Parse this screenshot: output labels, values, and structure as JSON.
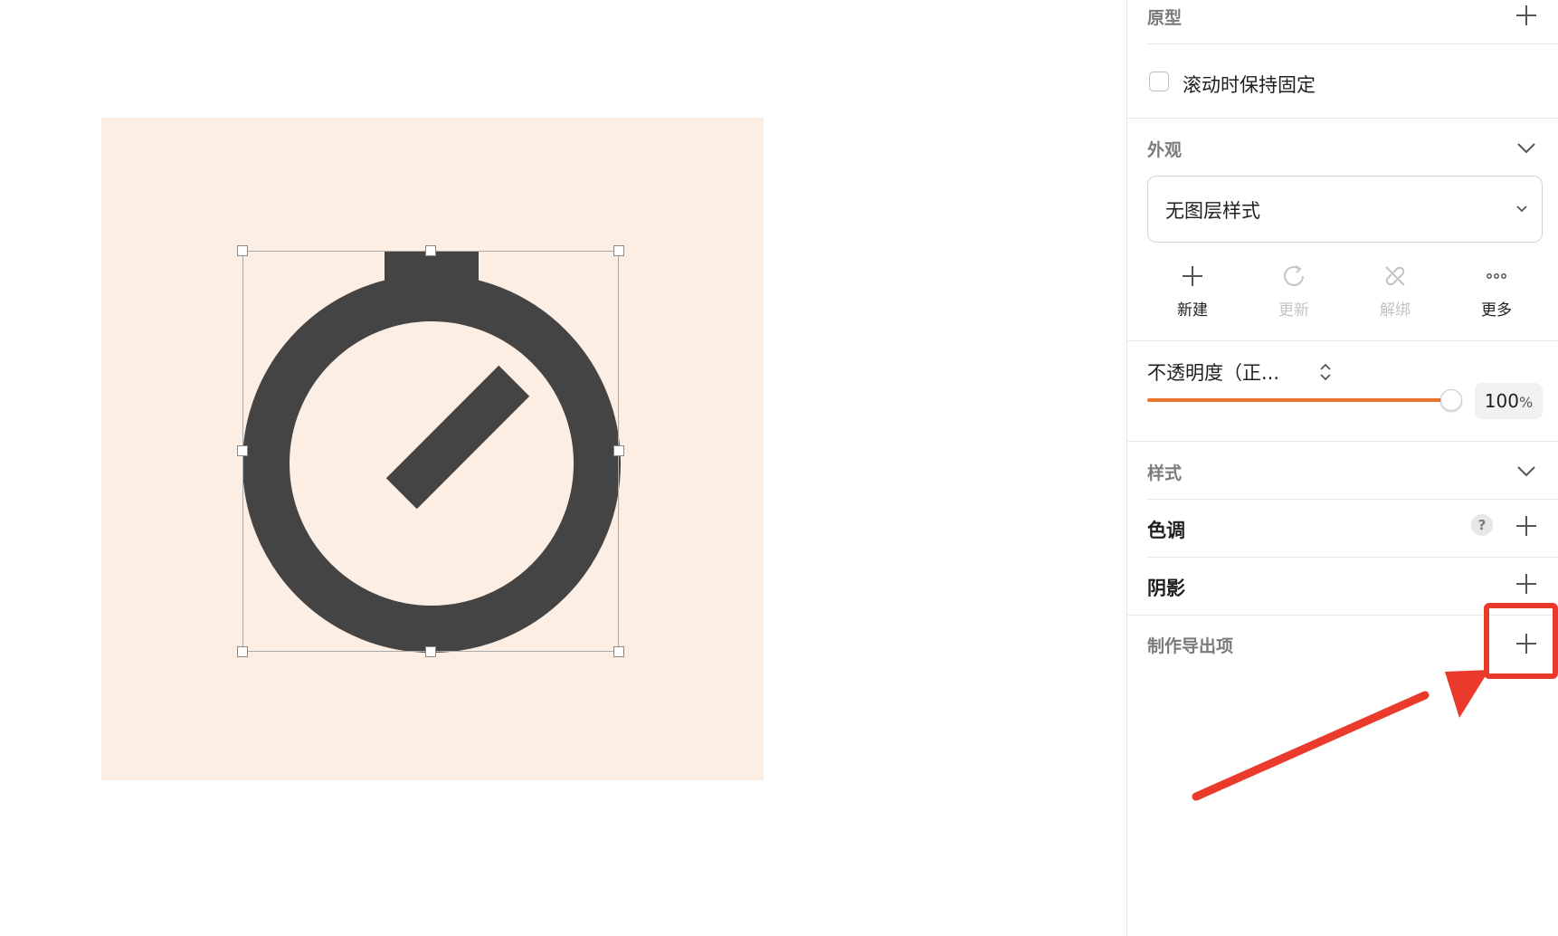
{
  "colors": {
    "artboard_bg": "#fdeee4",
    "icon_fill": "#444444",
    "slider_accent": "#e8742f",
    "annotation_red": "#ea3a2b"
  },
  "inspector": {
    "prototype": {
      "title": "原型",
      "add_icon": "plus-icon"
    },
    "fixed_on_scroll": {
      "label": "滚动时保持固定",
      "checked": false
    },
    "appearance": {
      "title": "外观",
      "layer_style": "无图层样式",
      "actions": [
        {
          "label": "新建",
          "icon": "plus-icon",
          "enabled": true
        },
        {
          "label": "更新",
          "icon": "refresh-icon",
          "enabled": false
        },
        {
          "label": "解绑",
          "icon": "unlink-icon",
          "enabled": false
        },
        {
          "label": "更多",
          "icon": "more-icon",
          "enabled": true
        }
      ],
      "opacity_label": "不透明度（正...",
      "opacity_value": "100",
      "opacity_unit": "%",
      "opacity_fraction": 1.0
    },
    "style": {
      "title": "样式"
    },
    "tint": {
      "title": "色调",
      "help": "?"
    },
    "shadow": {
      "title": "阴影"
    },
    "export": {
      "title": "制作导出项"
    }
  }
}
